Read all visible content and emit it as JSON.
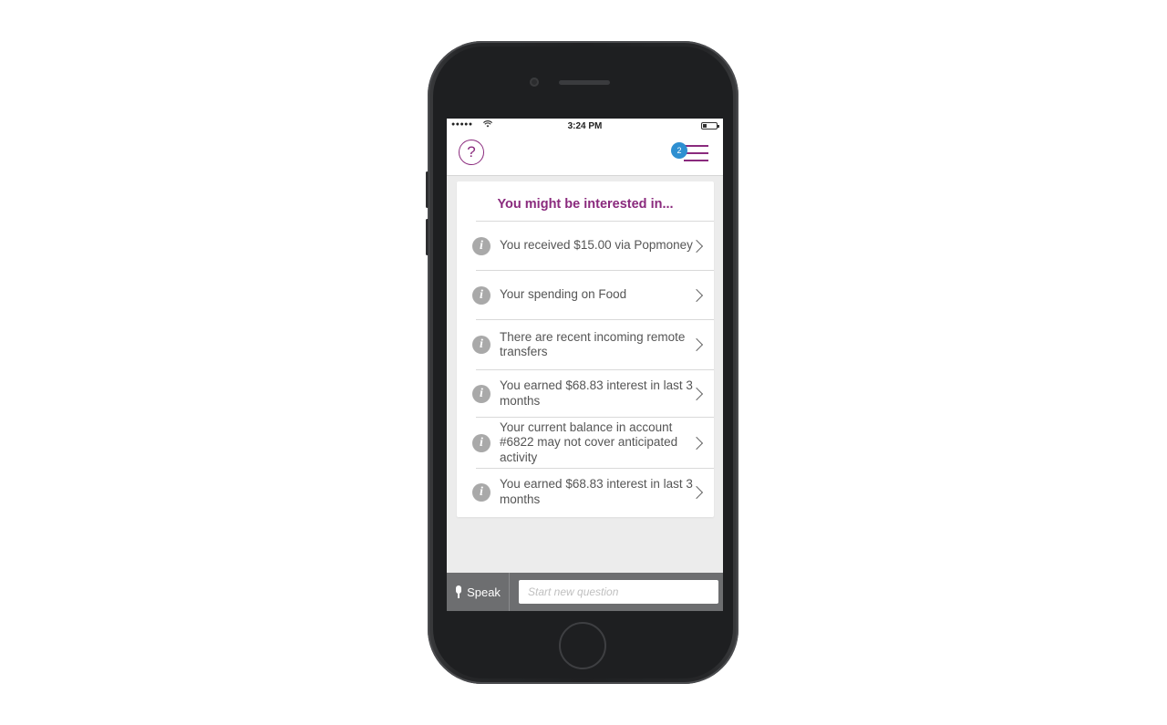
{
  "status_bar": {
    "signal": "●●●●●",
    "time": "3:24 PM"
  },
  "app_bar": {
    "help_icon_glyph": "?",
    "notification_count": "2"
  },
  "card": {
    "title": "You might be interested in...",
    "items": [
      {
        "text": "You received $15.00 via Popmoney"
      },
      {
        "text": "Your spending on Food"
      },
      {
        "text": "There are recent incoming remote transfers"
      },
      {
        "text": "You earned $68.83 interest in last 3 months"
      },
      {
        "text": "Your current balance in account #6822 may not cover anticipated activity"
      },
      {
        "text": "You earned $68.83 interest in last 3 months"
      }
    ]
  },
  "bottom_bar": {
    "speak_label": "Speak",
    "input_placeholder": "Start new question",
    "input_value": ""
  },
  "colors": {
    "accent": "#8a2a7d",
    "badge": "#2e8fd1",
    "bottom_bar": "#6d6e70",
    "info_icon": "#a9a9a9"
  },
  "icons": [
    "wifi-icon",
    "battery-icon",
    "help-icon",
    "hamburger-menu-icon",
    "info-icon",
    "chevron-right-icon",
    "microphone-icon"
  ]
}
